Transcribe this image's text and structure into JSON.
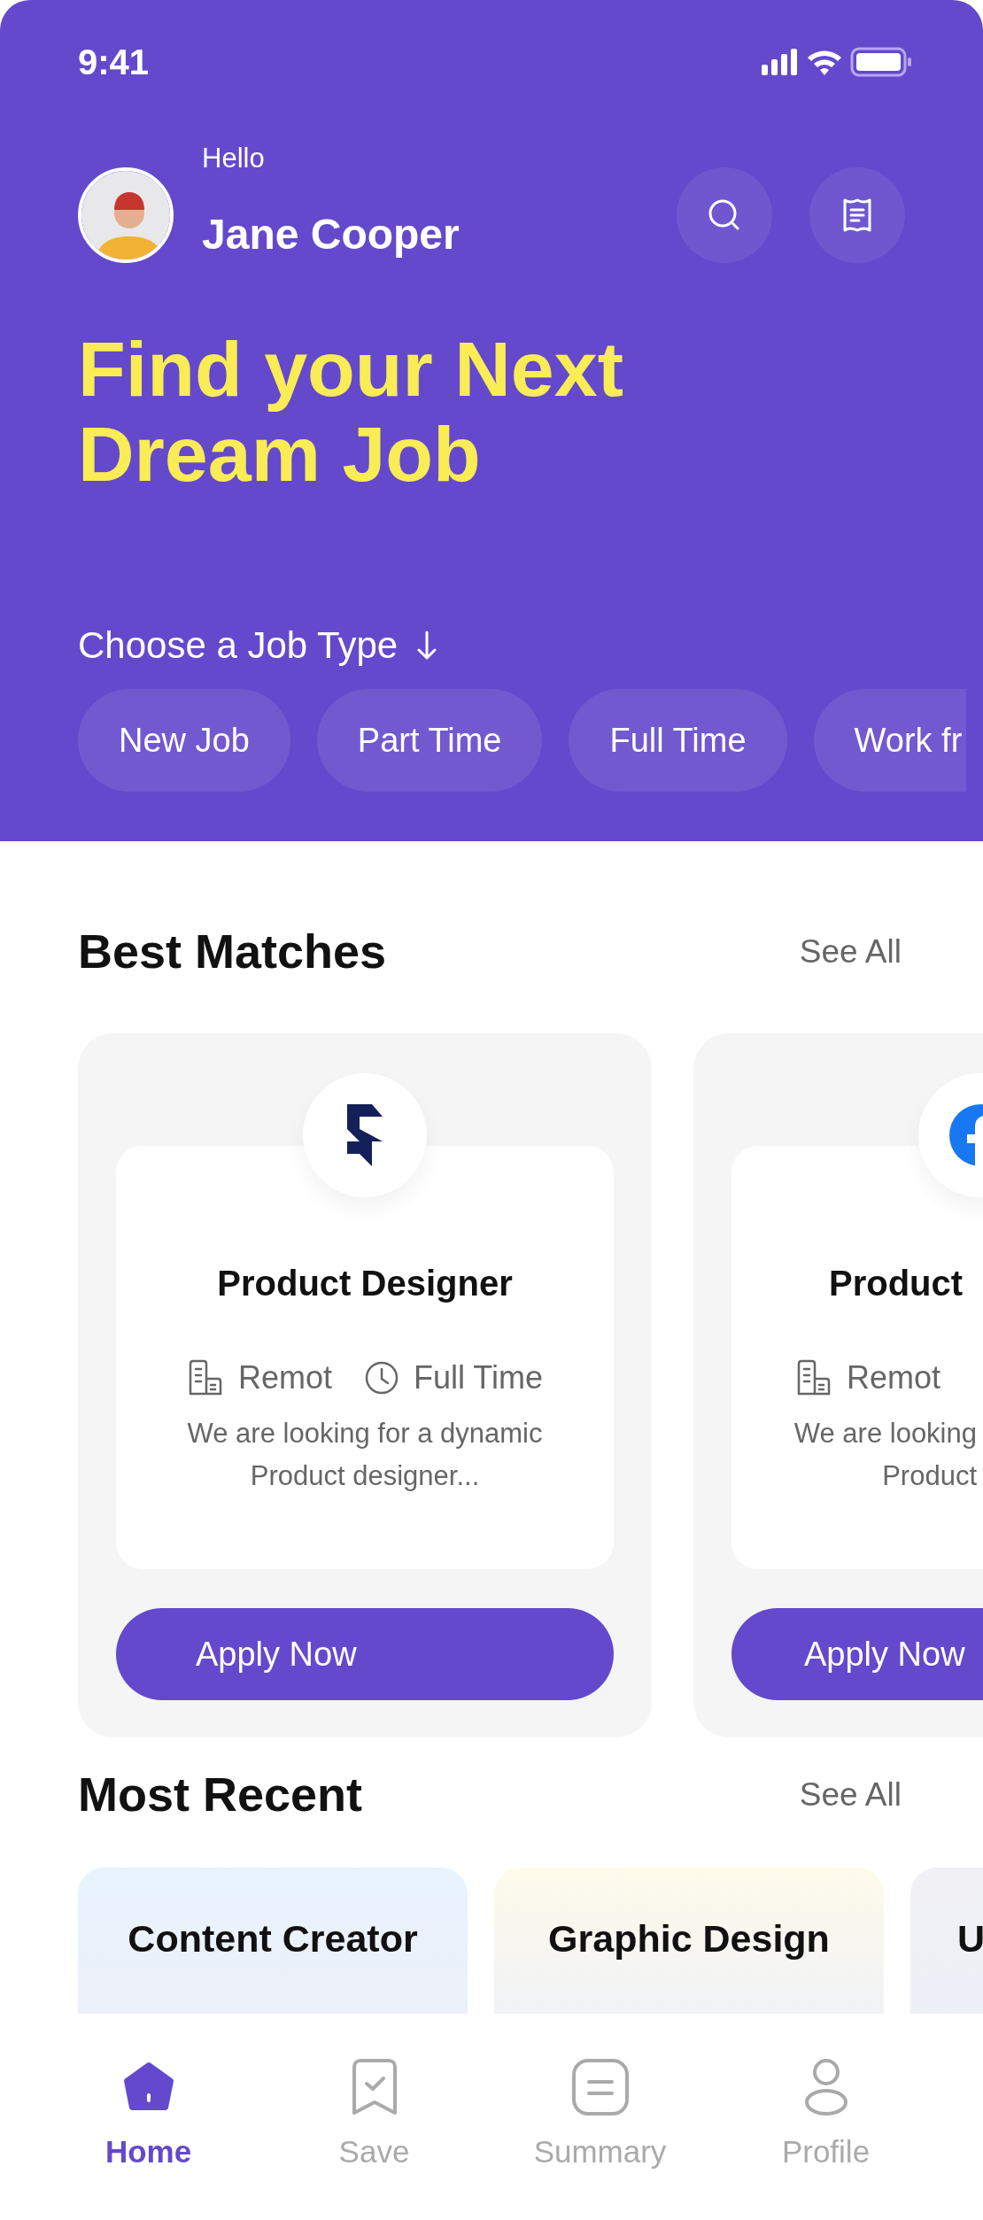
{
  "status_bar": {
    "time": "9:41"
  },
  "header": {
    "greeting": "Hello",
    "name": "Jane Cooper",
    "headline": "Find your Next Dream Job"
  },
  "job_types": {
    "label": "Choose a Job Type",
    "chips": [
      {
        "label": "New Job",
        "clipped": false
      },
      {
        "label": "Part Time",
        "clipped": false
      },
      {
        "label": "Full Time",
        "clipped": false
      },
      {
        "label": "Work fr",
        "clipped": true
      }
    ]
  },
  "best_matches": {
    "title": "Best Matches",
    "see_all": "See All",
    "jobs": [
      {
        "clipped": false,
        "title": "Product Designer",
        "location": "Remot",
        "type": "Full Time",
        "description": [
          "We are looking for a dynamic",
          "Product designer..."
        ],
        "button": "Apply Now"
      },
      {
        "clipped": true,
        "title": "Product",
        "location": "Remot",
        "description": [
          "We are looking",
          "Product"
        ],
        "button": "Apply Now"
      }
    ]
  },
  "most_recent": {
    "title": "Most Recent",
    "see_all": "See All",
    "items": [
      {
        "title": "Content Creator",
        "color": "#e8f3fe",
        "clipped": false
      },
      {
        "title": "Graphic Design",
        "color": "#fefbea",
        "clipped": false
      },
      {
        "title": "U",
        "color": "#f1f1f5",
        "clipped": true
      }
    ]
  },
  "bottom_nav": [
    {
      "label": "Home",
      "selected": true
    },
    {
      "label": "Save",
      "selected": false
    },
    {
      "label": "Summary",
      "selected": false
    },
    {
      "label": "Profile",
      "selected": false
    }
  ]
}
